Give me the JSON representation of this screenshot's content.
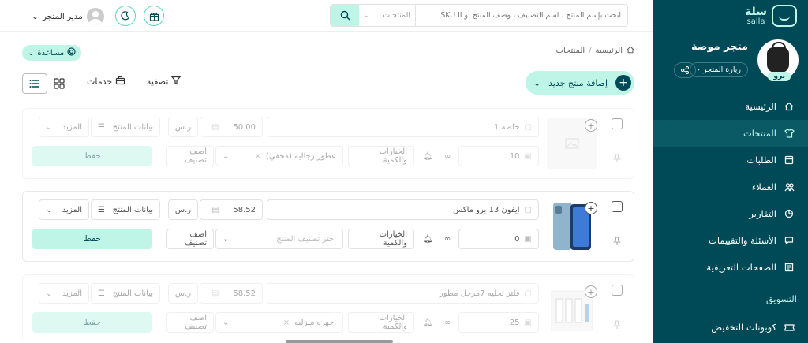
{
  "sidebar": {
    "logo_ar": "سلة",
    "logo_en": "salla",
    "store_name": "متجر موضة",
    "pro_badge": "برو",
    "visit_store": "زيارة المتجر",
    "items": [
      {
        "label": "الرئيسية",
        "icon": "home-icon",
        "active": false
      },
      {
        "label": "المنتجات",
        "icon": "shirt-icon",
        "active": true
      },
      {
        "label": "الطلبات",
        "icon": "orders-icon",
        "active": false
      },
      {
        "label": "العملاء",
        "icon": "users-icon",
        "active": false
      },
      {
        "label": "التقارير",
        "icon": "chart-icon",
        "active": false
      },
      {
        "label": "الأسئلة والتقييمات",
        "icon": "chat-icon",
        "active": false
      },
      {
        "label": "الصفحات التعريفية",
        "icon": "pages-icon",
        "active": false
      }
    ],
    "section_marketing": "التسويق",
    "coupons": "كوبونات التخفيض"
  },
  "topbar": {
    "search_placeholder": "ابحث بإسم المنتج ، اسم التصنيف ، وصف المنتج أو الـSKU",
    "search_category": "المنتجات",
    "user_name": "مدير المتجر"
  },
  "breadcrumb": {
    "home": "الرئيسية",
    "current": "المنتجات"
  },
  "toolbar": {
    "help": "مساعدة",
    "add_product": "إضافة منتج جديد",
    "filter": "تصفية",
    "services": "خدمات"
  },
  "labels": {
    "currency": "ر.س",
    "product_data": "بيانات المنتج",
    "more": "المزيد",
    "options_qty": "الخيارات والكمية",
    "add_category": "اضف تصنيف",
    "save": "حفظ",
    "choose_category": "اختر تصنيف المنتج"
  },
  "products": [
    {
      "name": "خلطه 1",
      "price": "50.00",
      "qty": "10",
      "category": "عطور رجالية (مخفي)",
      "faded": true
    },
    {
      "name": "ايفون 13 برو ماكس",
      "price": "58.52",
      "qty": "0",
      "category": "",
      "faded": false
    },
    {
      "name": "فلتر تحليه 7مرحل مطور",
      "price": "58.52",
      "qty": "25",
      "category": "اجهزه منزليه",
      "faded": true
    }
  ],
  "colors": {
    "primary": "#004956",
    "accent": "#bff5e6",
    "active_bg": "#0a5a66"
  }
}
